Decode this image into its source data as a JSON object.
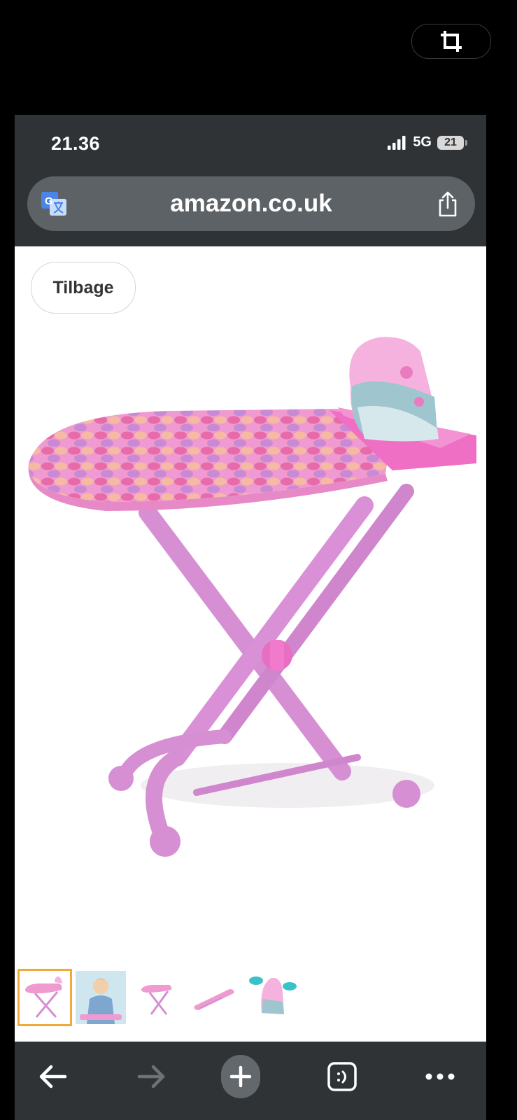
{
  "status_bar": {
    "time": "21.36",
    "network": "5G",
    "battery": "21"
  },
  "url_bar": {
    "url": "amazon.co.uk"
  },
  "page": {
    "back_label": "Tilbage"
  },
  "icons": {
    "crop": "crop-icon",
    "translate": "translate-icon",
    "share": "share-icon",
    "signal": "signal-icon",
    "back": "arrow-left-icon",
    "forward": "arrow-right-icon",
    "new_tab": "plus-icon",
    "tabs": "tabs-icon",
    "more": "more-icon"
  },
  "colors": {
    "browser_chrome": "#2f3336",
    "url_bar": "#5c6266",
    "thumbnail_selected": "#f0a93a"
  },
  "thumbnails": [
    {
      "subject": "ironing board",
      "selected": true
    },
    {
      "subject": "child ironing",
      "selected": false
    },
    {
      "subject": "ironing board",
      "selected": false
    },
    {
      "subject": "ironing board folded",
      "selected": false
    },
    {
      "subject": "toy iron",
      "selected": false
    }
  ]
}
